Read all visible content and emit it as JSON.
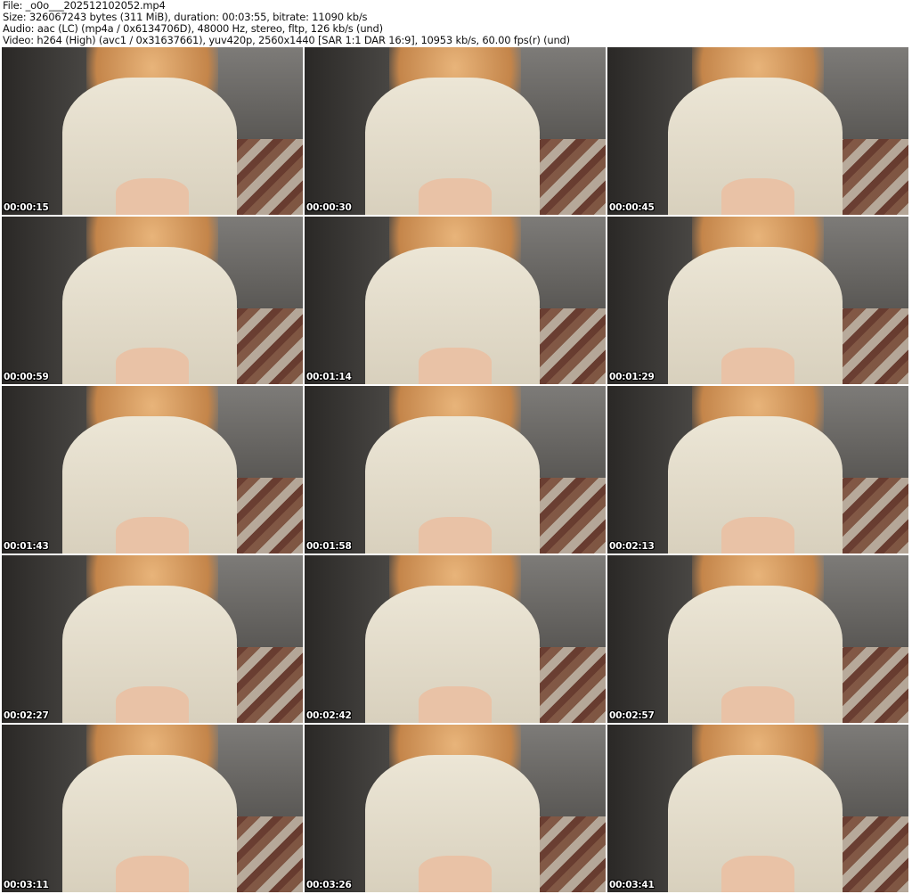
{
  "header": {
    "file": "File: _o0o___202512102052.mp4",
    "size": "Size: 326067243 bytes (311 MiB), duration: 00:03:55, bitrate: 11090 kb/s",
    "audio": "Audio: aac (LC) (mp4a / 0x6134706D), 48000 Hz, stereo, fltp, 126 kb/s (und)",
    "video": "Video: h264 (High) (avc1 / 0x31637661), yuv420p, 2560x1440 [SAR 1:1 DAR 16:9], 10953 kb/s, 60.00 fps(r) (und)"
  },
  "thumbnails": [
    {
      "timestamp": "00:00:15"
    },
    {
      "timestamp": "00:00:30"
    },
    {
      "timestamp": "00:00:45"
    },
    {
      "timestamp": "00:00:59"
    },
    {
      "timestamp": "00:01:14"
    },
    {
      "timestamp": "00:01:29"
    },
    {
      "timestamp": "00:01:43"
    },
    {
      "timestamp": "00:01:58"
    },
    {
      "timestamp": "00:02:13"
    },
    {
      "timestamp": "00:02:27"
    },
    {
      "timestamp": "00:02:42"
    },
    {
      "timestamp": "00:02:57"
    },
    {
      "timestamp": "00:03:11"
    },
    {
      "timestamp": "00:03:26"
    },
    {
      "timestamp": "00:03:41"
    }
  ]
}
